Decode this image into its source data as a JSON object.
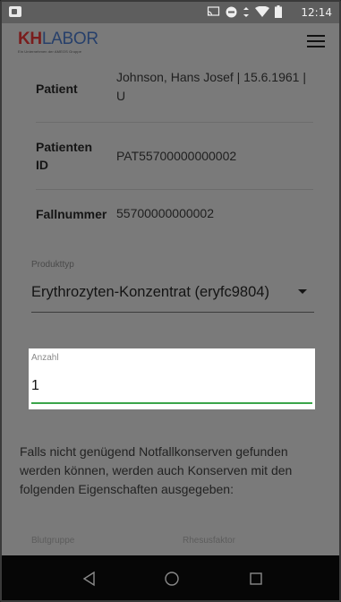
{
  "status_bar": {
    "time": "12:14",
    "icons": [
      "notification-icon",
      "cast-icon",
      "do-not-disturb-icon",
      "vibrate-icon",
      "wifi-icon",
      "battery-icon"
    ]
  },
  "app_bar": {
    "logo_kh": "KH",
    "logo_labor": "LABOR",
    "logo_tagline": "Ein Unternehmen der AMEOS Gruppe",
    "menu_icon": "hamburger-menu-icon"
  },
  "patient_info": [
    {
      "label": "Patient",
      "value": "Johnson, Hans Josef | 15.6.1961 | U"
    },
    {
      "label": "Patienten ID",
      "value": "PAT55700000000002"
    },
    {
      "label": "Fallnummer",
      "value": "55700000000002"
    }
  ],
  "product": {
    "label": "Produkttyp",
    "value": "Erythrozyten-Konzentrat (eryfc9804)"
  },
  "quantity": {
    "label": "Anzahl",
    "value": "1"
  },
  "note": "Falls nicht genügend Notfallkonserven gefunden werden können, werden auch Konserven mit den folgenden Eigenschaften ausgegeben:",
  "properties": {
    "blood_group_label": "Blutgruppe",
    "rhesus_label": "Rhesusfaktor"
  },
  "colors": {
    "accent": "#3aa54a",
    "overlay": "#7a7a7a",
    "logo_red": "#7a1d1d",
    "logo_blue": "#27406b"
  },
  "nav": [
    "back-icon",
    "home-icon",
    "recents-icon"
  ]
}
